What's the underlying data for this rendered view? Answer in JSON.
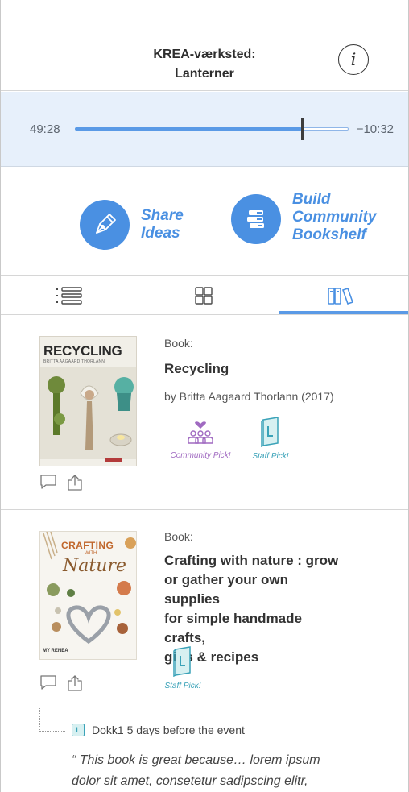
{
  "header": {
    "title_line1": "KREA-værksted:",
    "title_line2": "Lanterner",
    "info_glyph": "i"
  },
  "player": {
    "elapsed": "49:28",
    "remaining": "−10:32",
    "progress": 0.83
  },
  "actions": {
    "share_line1": "Share",
    "share_line2": "Ideas",
    "build_line1": "Build",
    "build_line2": "Community",
    "build_line3": "Bookshelf"
  },
  "tabs": [
    "list",
    "grid",
    "bookshelf"
  ],
  "active_tab": "bookshelf",
  "colors": {
    "accent": "#4a90e2",
    "audio_bg": "#e7f0fb",
    "community": "#a06ac1",
    "staff": "#3aa2b8"
  },
  "items": [
    {
      "type": "Book:",
      "title": "Recycling",
      "author": "by Britta Aagaard Thorlann (2017)",
      "cover_title": "RECYCLING",
      "cover_author": "BRITTA AAGAARD THORLANN",
      "badges": [
        "Community Pick!",
        "Staff Pick!"
      ]
    },
    {
      "type": "Book:",
      "title_lines": [
        "Crafting with nature : grow",
        "or gather your own supplies",
        "for simple handmade crafts,",
        "gifts & recipes"
      ],
      "cover_title_a": "CRAFTING",
      "cover_title_b": "WITH",
      "cover_title_c": "Nature",
      "cover_author": "MY RENEA",
      "badges": [
        "Staff Pick!"
      ],
      "review": {
        "author": "Dokk1 5 days before the event",
        "quote_lines": [
          "“ This book is great because… lorem ipsum",
          "dolor sit amet, consetetur sadipscing elitr,"
        ]
      }
    }
  ]
}
